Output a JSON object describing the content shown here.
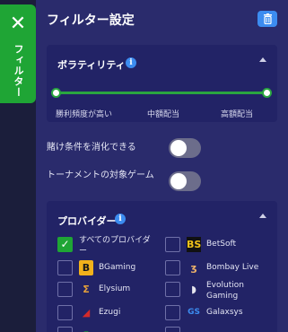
{
  "sidebar_tab": {
    "close_glyph": "✕",
    "label": "フィルター"
  },
  "header": {
    "title": "フィルター設定",
    "trash_icon": "trash-icon"
  },
  "volatility": {
    "title": "ボラティリティ",
    "labels": [
      "勝利頻度が高い",
      "中額配当",
      "高額配当"
    ]
  },
  "toggles": [
    {
      "label": "賭け条件を消化できる",
      "on": false
    },
    {
      "label": "トーナメントの対象ゲーム",
      "on": false
    }
  ],
  "providers": {
    "title": "プロバイダー",
    "items": [
      {
        "name": "すべてのプロバイダー",
        "checked": true,
        "logo": ""
      },
      {
        "name": "BetSoft",
        "checked": false,
        "logo": "BS"
      },
      {
        "name": "BGaming",
        "checked": false,
        "logo": "B"
      },
      {
        "name": "Bombay Live",
        "checked": false,
        "logo": "ʒ"
      },
      {
        "name": "Elysium",
        "checked": false,
        "logo": "Σ"
      },
      {
        "name": "Evolution Gaming",
        "checked": false,
        "logo": "◗"
      },
      {
        "name": "Ezugi",
        "checked": false,
        "logo": "◢"
      },
      {
        "name": "Galaxsys",
        "checked": false,
        "logo": "GS"
      },
      {
        "name": "",
        "checked": false,
        "logo": ""
      },
      {
        "name": "",
        "checked": false,
        "logo": ""
      }
    ]
  },
  "colors": {
    "accent_green": "#1fa535",
    "panel": "#2a2b6c",
    "card": "#222366",
    "info_blue": "#3c8cf0"
  }
}
